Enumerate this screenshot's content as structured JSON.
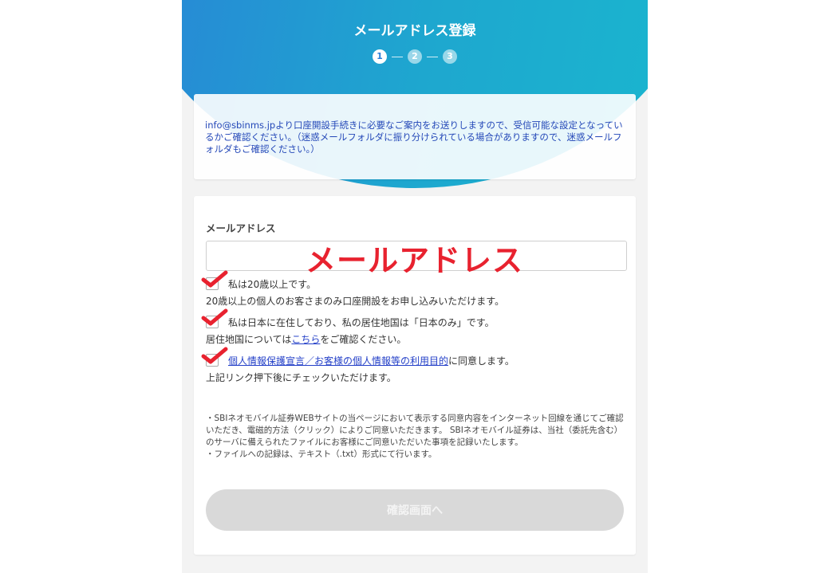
{
  "header": {
    "title": "メールアドレス登録",
    "steps": [
      "1",
      "2",
      "3"
    ],
    "current_step": 1,
    "gradient_start": "#2a7fd8",
    "gradient_end": "#19b8cf"
  },
  "notice": {
    "text": "info@sbinms.jpより口座開設手続きに必要なご案内をお送りしますので、受信可能な設定となっているかご確認ください。（迷惑メールフォルダに振り分けられている場合がありますので、迷惑メールフォルダもご確認ください。）",
    "color": "#2448b8"
  },
  "form": {
    "email_label": "メールアドレス",
    "email_value": "",
    "annotation": "メールアドレス",
    "annotation_color": "#e8222f",
    "checks": [
      {
        "label": "私は20歳以上です。",
        "sub": "20歳以上の個人のお客さまのみ口座開設をお申し込みいただけます。",
        "checked_mark": "red-checkmark-icon"
      },
      {
        "label": "私は日本に在住しており、私の居住地国は「日本のみ」です。",
        "sub_prefix": "居住地国については",
        "sub_link": "こちら",
        "sub_suffix": "をご確認ください。",
        "checked_mark": "red-checkmark-icon"
      },
      {
        "label_link": "個人情報保護宣言／お客様の個人情報等の利用目的",
        "label_suffix": "に同意します。",
        "sub": "上記リンク押下後にチェックいただけます。",
        "checked_mark": "red-checkmark-icon"
      }
    ],
    "disclaimer_1": "・SBIネオモバイル証券WEBサイトの当ページにおいて表示する同意内容をインターネット回線を通じてご確認いただき、電磁的方法（クリック）によりご同意いただきます。 SBIネオモバイル証券は、当社（委託先含む）のサーバに備えられたファイルにお客様にご同意いただいた事項を記録いたします。",
    "disclaimer_2": "・ファイルへの記録は、テキスト（.txt）形式にて行います。",
    "button_label": "確認画面へ"
  }
}
